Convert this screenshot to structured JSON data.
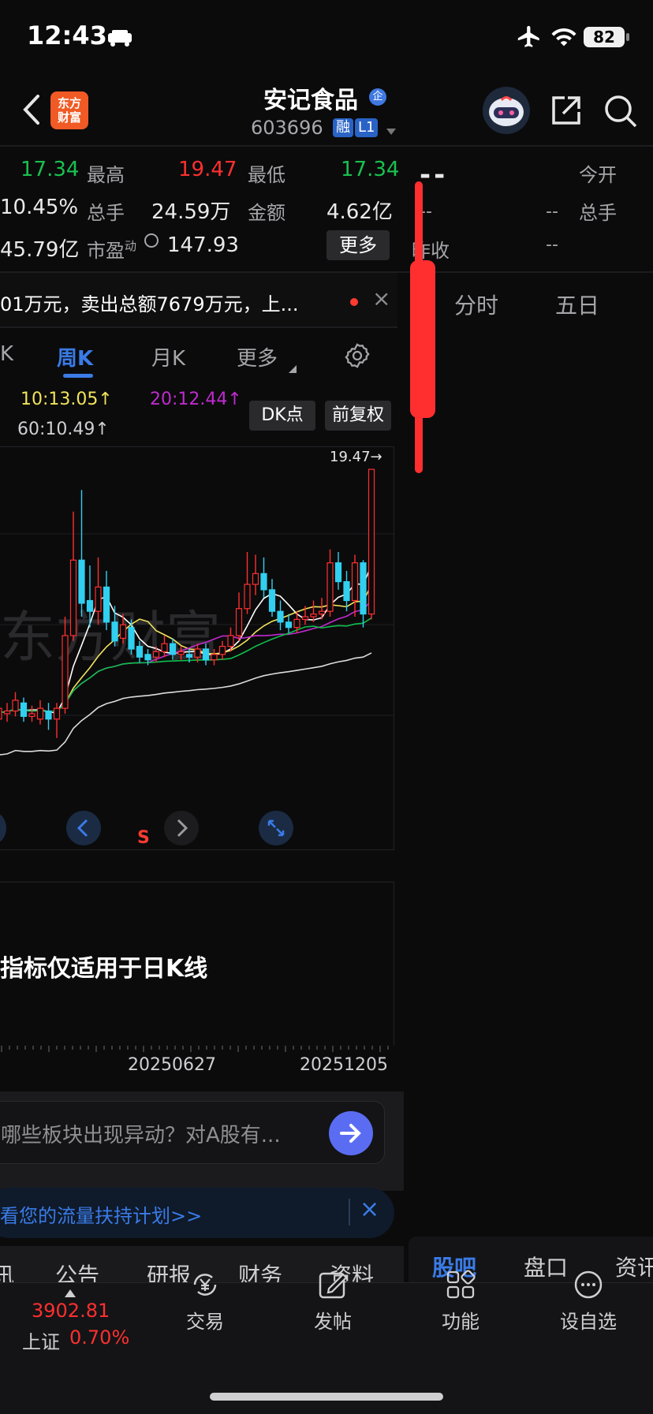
{
  "status": {
    "time": "12:43",
    "battery": "82",
    "icons": [
      "car-icon",
      "airplane-icon",
      "wifi-icon",
      "battery-icon"
    ]
  },
  "header": {
    "logo_text": "东方\n财富",
    "stock_name": "安记食品",
    "badge_enterprise": "企",
    "stock_code": "603696",
    "tag_margin": "融",
    "tag_level": "L1"
  },
  "quote_left": {
    "row1": {
      "v1": "17.34",
      "k1": "最高",
      "v2": "19.47",
      "k2": "最低",
      "v3": "17.34"
    },
    "row2": {
      "v1": "10.45%",
      "k1": "总手",
      "v2": "24.59万",
      "k2": "金额",
      "v3": "4.62亿"
    },
    "row3": {
      "v1": "45.79亿",
      "k1": "市盈",
      "k1_sup": "动",
      "v2": "147.93",
      "more_btn": "更多"
    }
  },
  "quote_right": {
    "price_dash": "--",
    "k_open": "今开",
    "k_volume": "总手",
    "k_prev": "昨收",
    "v_dash1": "--",
    "v_dash2": "--",
    "v_dash3": "--",
    "k_prev_partial": "昨收"
  },
  "ticker": {
    "text": "01万元，卖出总额7679万元，上...",
    "close": "×"
  },
  "tabs": {
    "k_partial": "K",
    "week": "周K",
    "month": "月K",
    "more": "更多",
    "right_tabs": [
      "分时",
      "五日"
    ]
  },
  "chart_controls": {
    "ma10": "10:13.05↑",
    "ma20": "20:12.44↑",
    "ma60": "60:10.49↑",
    "dk_btn": "DK点",
    "adj_btn": "前复权",
    "price_tag": "19.47→",
    "watermark": "东方财富",
    "s_marker": "S"
  },
  "chart_data": {
    "type": "candlestick",
    "x_ticks": [
      "20250627",
      "20251205"
    ],
    "ylim": [
      8,
      20
    ],
    "candles": [
      {
        "o": 10.1,
        "c": 10.3,
        "h": 10.6,
        "l": 9.9
      },
      {
        "o": 10.2,
        "c": 10.6,
        "h": 10.9,
        "l": 10.0
      },
      {
        "o": 10.4,
        "c": 10.5,
        "h": 10.8,
        "l": 10.1
      },
      {
        "o": 10.5,
        "c": 10.9,
        "h": 11.2,
        "l": 10.3
      },
      {
        "o": 10.8,
        "c": 10.3,
        "h": 11.0,
        "l": 10.1
      },
      {
        "o": 10.3,
        "c": 10.4,
        "h": 10.7,
        "l": 10.1
      },
      {
        "o": 10.2,
        "c": 10.6,
        "h": 10.9,
        "l": 10.0
      },
      {
        "o": 10.5,
        "c": 10.2,
        "h": 10.8,
        "l": 9.8
      },
      {
        "o": 10.2,
        "c": 10.6,
        "h": 10.8,
        "l": 9.5
      },
      {
        "o": 10.6,
        "c": 13.3,
        "h": 14.0,
        "l": 10.4
      },
      {
        "o": 13.3,
        "c": 16.1,
        "h": 17.9,
        "l": 13.1
      },
      {
        "o": 16.1,
        "c": 14.5,
        "h": 18.7,
        "l": 14.0
      },
      {
        "o": 14.6,
        "c": 14.2,
        "h": 15.9,
        "l": 13.6
      },
      {
        "o": 14.2,
        "c": 15.1,
        "h": 16.2,
        "l": 13.7
      },
      {
        "o": 15.1,
        "c": 13.8,
        "h": 15.7,
        "l": 13.5
      },
      {
        "o": 13.8,
        "c": 13.1,
        "h": 14.4,
        "l": 12.9
      },
      {
        "o": 13.2,
        "c": 13.7,
        "h": 14.1,
        "l": 13.0
      },
      {
        "o": 13.6,
        "c": 12.8,
        "h": 13.9,
        "l": 12.6
      },
      {
        "o": 12.9,
        "c": 12.5,
        "h": 13.1,
        "l": 12.3
      },
      {
        "o": 12.6,
        "c": 12.4,
        "h": 12.8,
        "l": 12.2
      },
      {
        "o": 12.5,
        "c": 12.7,
        "h": 12.9,
        "l": 12.3
      },
      {
        "o": 12.7,
        "c": 13.0,
        "h": 13.3,
        "l": 12.5
      },
      {
        "o": 13.0,
        "c": 12.6,
        "h": 13.2,
        "l": 12.4
      },
      {
        "o": 12.6,
        "c": 12.7,
        "h": 12.9,
        "l": 12.4
      },
      {
        "o": 12.6,
        "c": 12.5,
        "h": 12.8,
        "l": 12.3
      },
      {
        "o": 12.5,
        "c": 12.8,
        "h": 13.0,
        "l": 12.3
      },
      {
        "o": 12.8,
        "c": 12.4,
        "h": 13.0,
        "l": 12.2
      },
      {
        "o": 12.4,
        "c": 12.6,
        "h": 12.8,
        "l": 12.2
      },
      {
        "o": 12.6,
        "c": 12.9,
        "h": 13.1,
        "l": 12.4
      },
      {
        "o": 12.9,
        "c": 13.3,
        "h": 13.6,
        "l": 12.7
      },
      {
        "o": 13.3,
        "c": 14.3,
        "h": 14.9,
        "l": 13.1
      },
      {
        "o": 14.3,
        "c": 15.2,
        "h": 16.4,
        "l": 14.1
      },
      {
        "o": 15.2,
        "c": 15.6,
        "h": 16.3,
        "l": 14.8
      },
      {
        "o": 15.6,
        "c": 15.0,
        "h": 16.2,
        "l": 14.7
      },
      {
        "o": 15.0,
        "c": 14.2,
        "h": 15.4,
        "l": 14.0
      },
      {
        "o": 14.2,
        "c": 13.8,
        "h": 14.6,
        "l": 13.5
      },
      {
        "o": 13.8,
        "c": 13.6,
        "h": 14.1,
        "l": 13.4
      },
      {
        "o": 13.6,
        "c": 13.9,
        "h": 14.2,
        "l": 13.4
      },
      {
        "o": 13.9,
        "c": 14.0,
        "h": 14.4,
        "l": 13.7
      },
      {
        "o": 14.0,
        "c": 14.1,
        "h": 14.6,
        "l": 13.8
      },
      {
        "o": 14.1,
        "c": 14.2,
        "h": 14.7,
        "l": 13.9
      },
      {
        "o": 14.2,
        "c": 16.0,
        "h": 16.5,
        "l": 14.0
      },
      {
        "o": 16.0,
        "c": 15.3,
        "h": 16.4,
        "l": 15.0
      },
      {
        "o": 15.3,
        "c": 14.6,
        "h": 15.7,
        "l": 14.2
      },
      {
        "o": 14.6,
        "c": 16.0,
        "h": 16.3,
        "l": 14.0
      },
      {
        "o": 16.0,
        "c": 14.1,
        "h": 16.1,
        "l": 13.6
      },
      {
        "o": 14.1,
        "c": 19.47,
        "h": 19.47,
        "l": 13.9
      }
    ],
    "ma_colors": {
      "ma5": "#ffffff",
      "ma10": "#f2e35b",
      "ma20": "#c02acf",
      "ma30": "#0fbf4b",
      "ma60": "#dcdcdc"
    }
  },
  "indicator_panel": {
    "note": "指标仅适用于日K线"
  },
  "search": {
    "placeholder": "哪些板块出现异动？对A股有..."
  },
  "promo": {
    "text": "看您的流量扶持计划>>"
  },
  "section_tabs": {
    "left": [
      "讯",
      "公告",
      "研报",
      "财务",
      "资料"
    ],
    "right": [
      "股吧",
      "盘口",
      "资讯"
    ]
  },
  "index": {
    "value": "3902.81",
    "name": "上证",
    "change": "0.70%"
  },
  "bottom_nav": [
    {
      "label": "交易",
      "icon": "yuan-icon"
    },
    {
      "label": "发帖",
      "icon": "edit-icon"
    },
    {
      "label": "功能",
      "icon": "grid-icon"
    },
    {
      "label": "设自选",
      "icon": "chat-icon"
    }
  ],
  "colors": {
    "up": "#ff2f2f",
    "down": "#19c14e",
    "accent": "#3a7be6"
  }
}
